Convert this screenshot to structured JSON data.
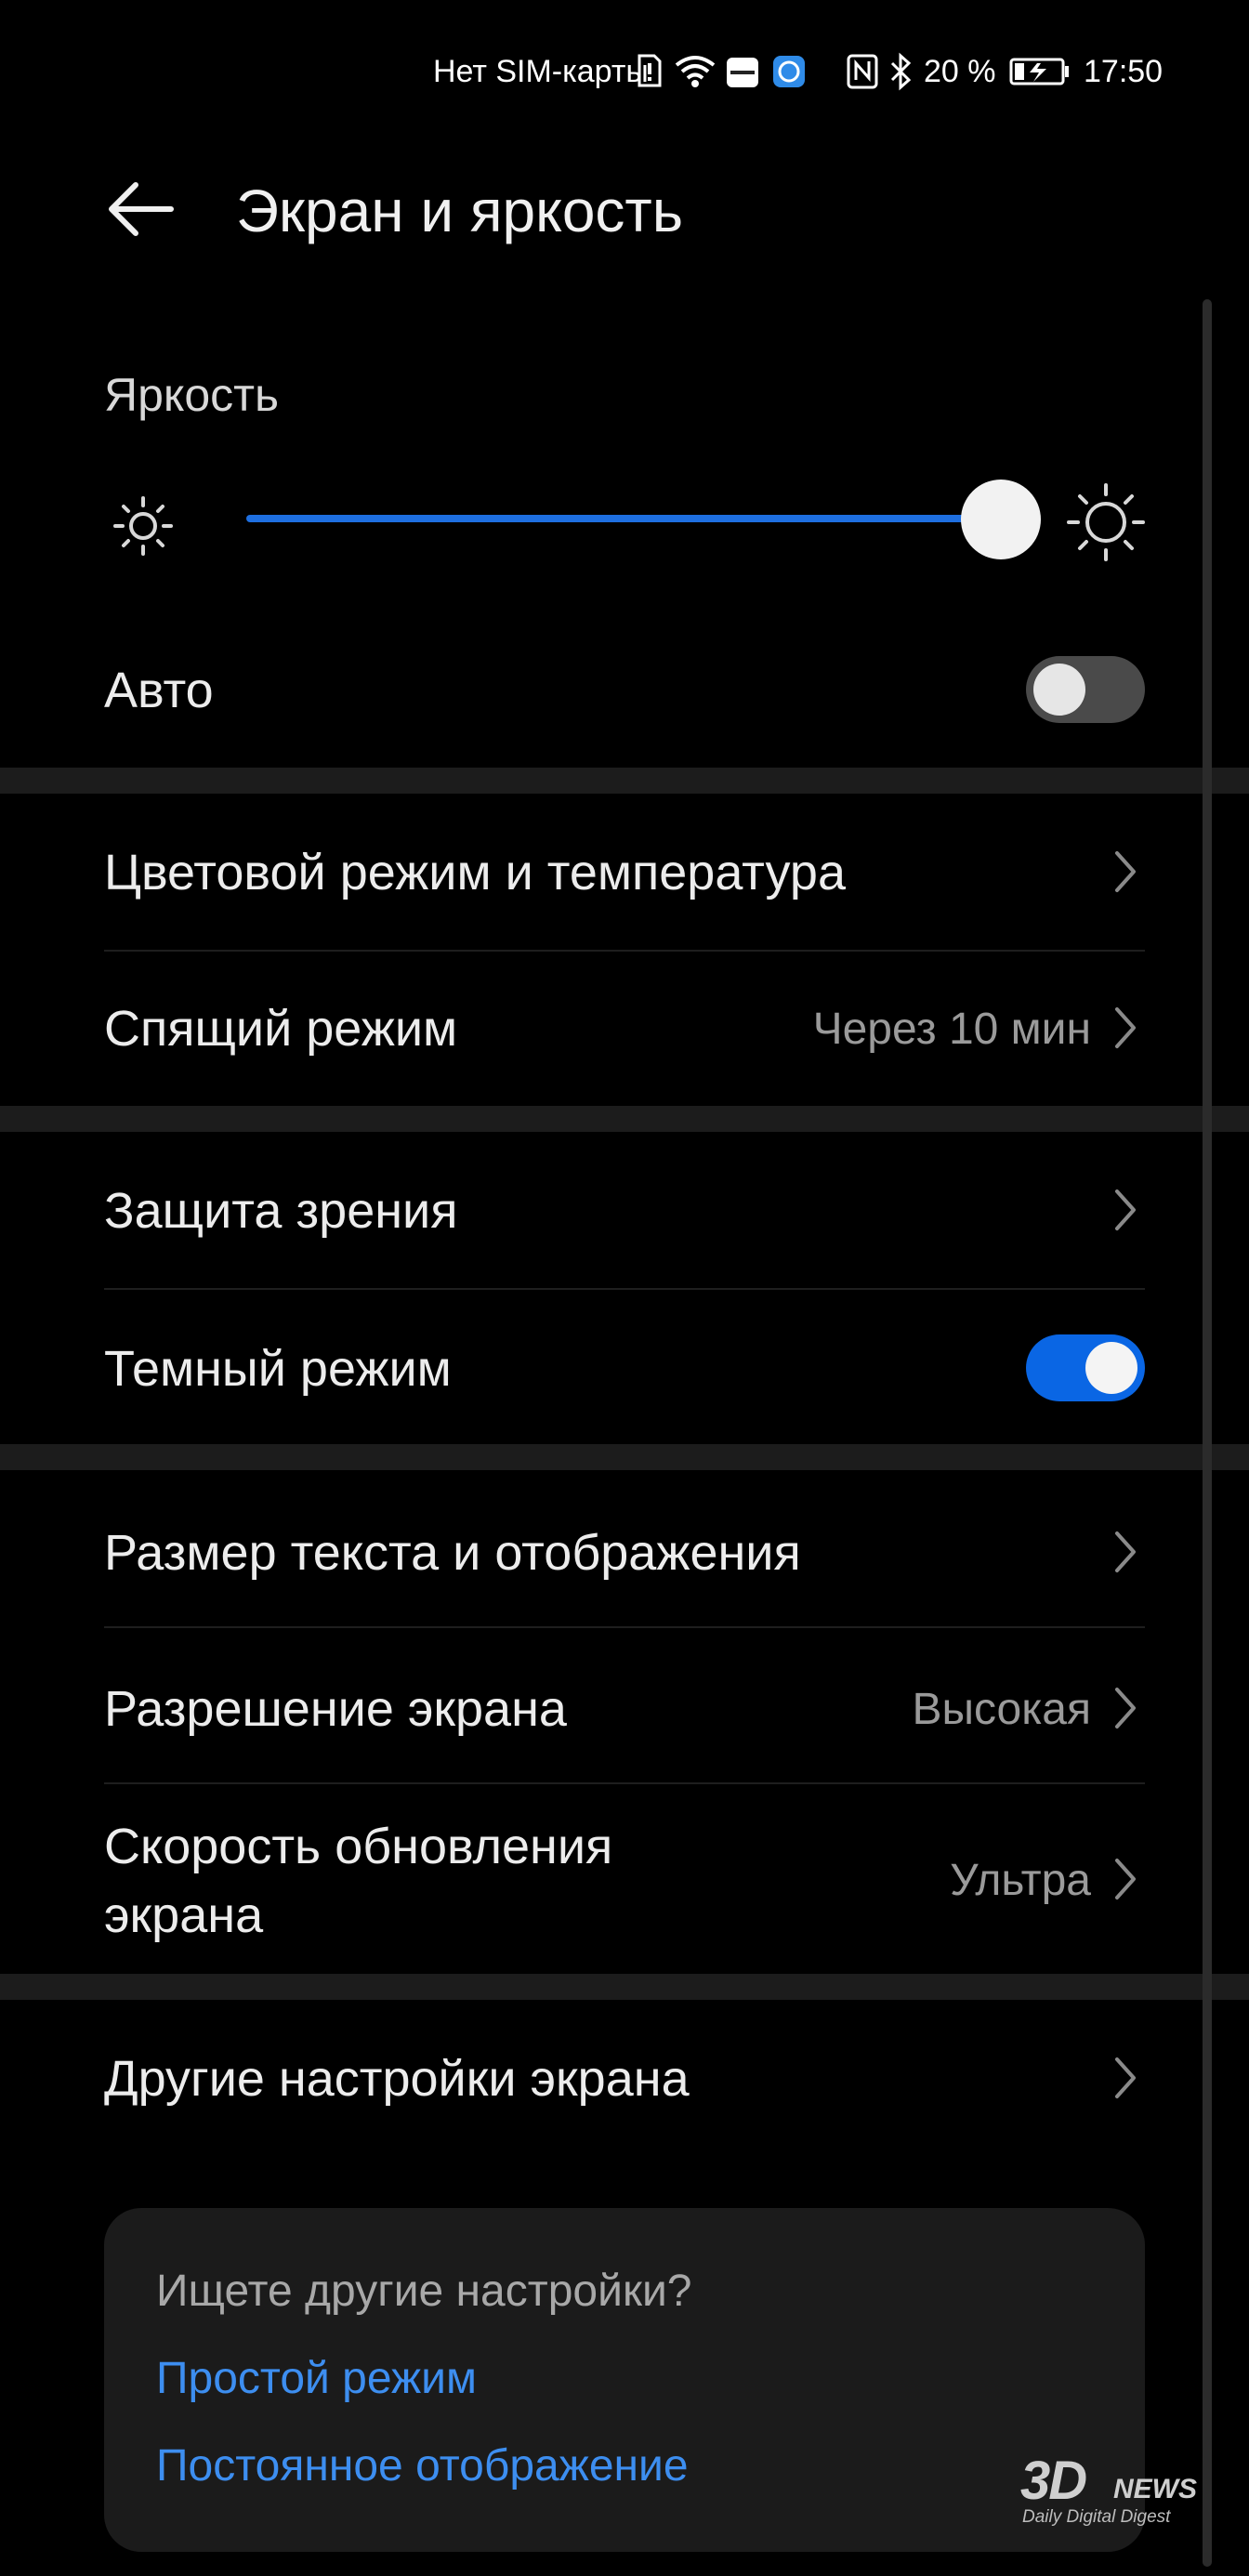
{
  "status_bar": {
    "carrier": "Нет SIM-карты",
    "battery_percent": "20 %",
    "time": "17:50",
    "icons": [
      "sim-alert-icon",
      "wifi-icon",
      "huawei-app-icon",
      "app-icon",
      "nfc-icon",
      "bluetooth-icon",
      "battery-charging-icon"
    ]
  },
  "header": {
    "title": "Экран и яркость",
    "back_icon": "arrow-left-icon"
  },
  "brightness": {
    "label": "Яркость",
    "level_percent": 91,
    "low_icon": "sun-small-icon",
    "high_icon": "sun-large-icon",
    "auto_label": "Авто",
    "auto_enabled": false
  },
  "groups": [
    {
      "rows": [
        {
          "label": "Цветовой режим и температура",
          "value": ""
        },
        {
          "label": "Спящий режим",
          "value": "Через 10 мин"
        }
      ]
    },
    {
      "rows": [
        {
          "label": "Защита зрения",
          "value": ""
        },
        {
          "label": "Темный режим",
          "toggle": true
        }
      ]
    },
    {
      "rows": [
        {
          "label": "Размер текста и отображения",
          "value": ""
        },
        {
          "label": "Разрешение экрана",
          "value": "Высокая"
        },
        {
          "label_line1": "Скорость обновления",
          "label_line2": "экрана",
          "value": "Ультра"
        }
      ]
    },
    {
      "rows": [
        {
          "label": "Другие настройки экрана",
          "value": ""
        }
      ]
    }
  ],
  "suggestions": {
    "title": "Ищете другие настройки?",
    "links": [
      "Простой режим",
      "Постоянное отображение"
    ]
  },
  "watermark": {
    "brand": "3D",
    "brand_suffix": "NEWS",
    "tagline": "Daily Digital Digest"
  },
  "colors": {
    "accent": "#1e6fe0",
    "link": "#3d8ef0",
    "toggle_off_track": "#4a4a4a",
    "toggle_off_knob": "#e6e6e6",
    "toggle_on_track": "#0a66e4",
    "toggle_on_knob": "#f4f4f4"
  }
}
